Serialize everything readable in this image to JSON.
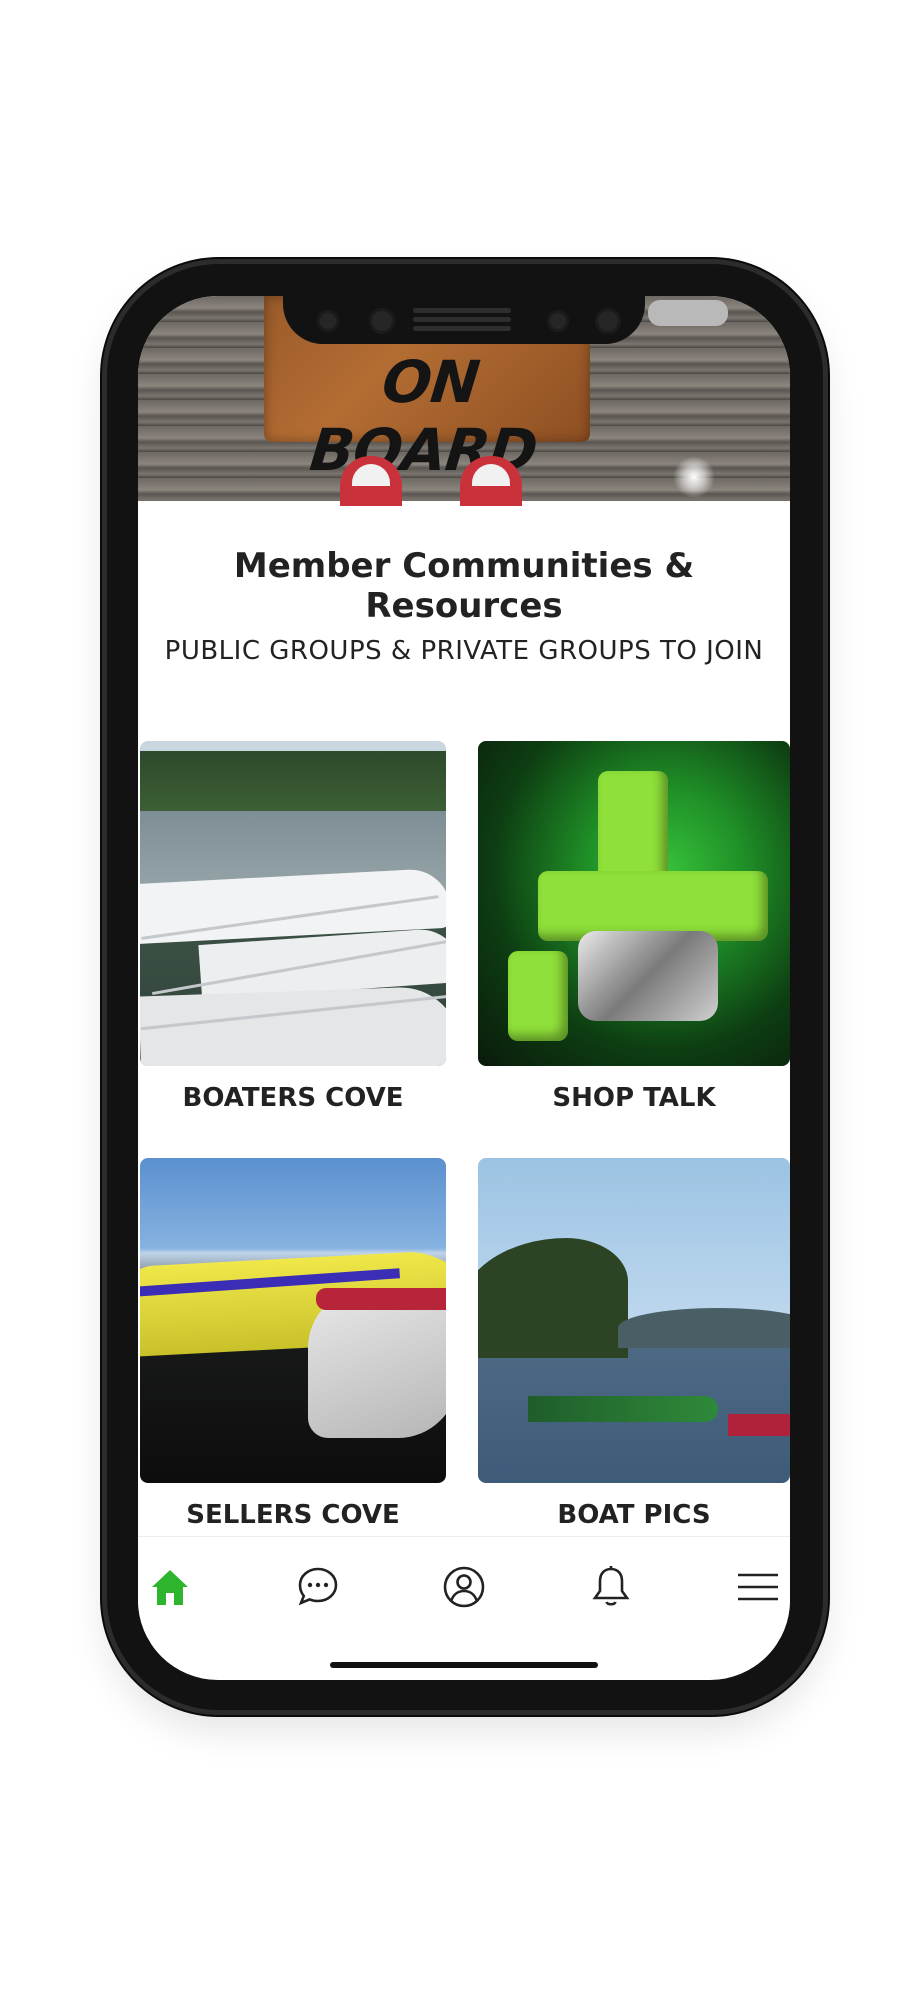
{
  "hero": {
    "mat_text": "ON BOARD"
  },
  "header": {
    "title": "Member Communities & Resources",
    "subtitle": "PUBLIC GROUPS & PRIVATE GROUPS TO JOIN"
  },
  "groups": [
    {
      "label": "BOATERS COVE"
    },
    {
      "label": "SHOP TALK"
    },
    {
      "label": "SELLERS COVE"
    },
    {
      "label": "BOAT PICS"
    }
  ],
  "tabbar": {
    "accent_color": "#2db52d",
    "inactive_color": "#222222",
    "tabs": [
      {
        "icon": "home-icon",
        "active": true
      },
      {
        "icon": "chat-icon",
        "active": false
      },
      {
        "icon": "profile-icon",
        "active": false
      },
      {
        "icon": "bell-icon",
        "active": false
      },
      {
        "icon": "menu-icon",
        "active": false
      }
    ]
  }
}
